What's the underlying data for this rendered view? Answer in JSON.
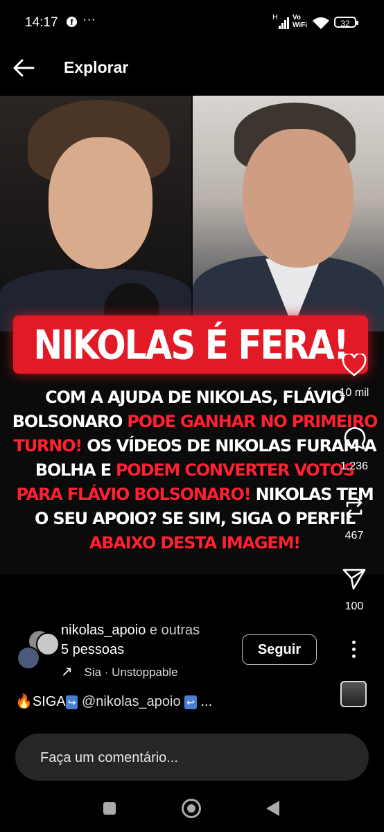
{
  "status_bar": {
    "time": "14:17",
    "app_icon": "facebook-icon",
    "more": "···",
    "signal_label": "H",
    "vowifi_line1": "Vo",
    "vowifi_line2": "WiFi",
    "battery": "32"
  },
  "header": {
    "back_icon": "arrow-left-icon",
    "title": "Explorar"
  },
  "post": {
    "headline": "NIKOLAS É FERA!",
    "body": [
      {
        "text": "COM A AJUDA DE NIKOLAS, FLÁVIO ",
        "color": "white"
      },
      {
        "text": "BOLSONARO ",
        "color": "white"
      },
      {
        "text": "PODE GANHAR NO PRIMEIRO TURNO!",
        "color": "red"
      },
      {
        "text": " OS VÍDEOS DE NIKOLAS FURAM A BOLHA E ",
        "color": "white"
      },
      {
        "text": "PODEM CONVERTER VOTOS PARA FLÁVIO BOLSONARO!",
        "color": "red"
      },
      {
        "text": " NIKOLAS TEM O SEU APOIO? SE SIM, SIGA O PERFIL ",
        "color": "white"
      },
      {
        "text": "ABAIXO DESTA IMAGEM!",
        "color": "red"
      }
    ],
    "headline_color": "#e11a25",
    "accent_red": "#ff2030"
  },
  "actions": {
    "likes": "10 mil",
    "comments": "1.236",
    "reposts": "467",
    "shares": "100"
  },
  "author": {
    "username": "nikolas_apoio",
    "others_text": "e outras",
    "people": "5 pessoas",
    "music_arrow": "↗",
    "music": "Sia · Unstoppable",
    "follow_label": "Seguir"
  },
  "caption": {
    "prefix": "🔥SIGA",
    "mention": "@nikolas_apoio",
    "more": "..."
  },
  "comment_box": {
    "placeholder": "Faça um comentário..."
  }
}
